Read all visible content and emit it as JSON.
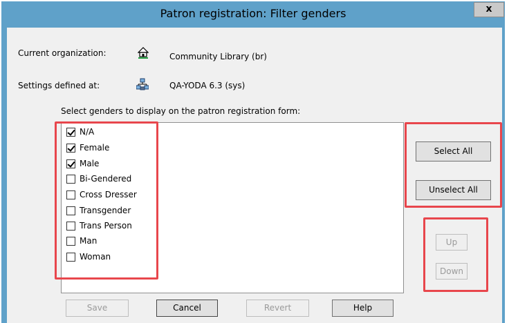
{
  "window": {
    "title": "Patron registration: Filter genders",
    "close_label": "x"
  },
  "info": {
    "current_org_label": "Current organization:",
    "current_org_value": "Community Library  (br)",
    "settings_label": "Settings defined at:",
    "settings_value": "QA-YODA 6.3 (sys)"
  },
  "instruction": "Select genders to display on the patron registration form:",
  "genders": [
    {
      "label": "N/A",
      "checked": true
    },
    {
      "label": "Female",
      "checked": true
    },
    {
      "label": "Male",
      "checked": true
    },
    {
      "label": "Bi-Gendered",
      "checked": false
    },
    {
      "label": "Cross Dresser",
      "checked": false
    },
    {
      "label": "Transgender",
      "checked": false
    },
    {
      "label": "Trans Person",
      "checked": false
    },
    {
      "label": "Man",
      "checked": false
    },
    {
      "label": "Woman",
      "checked": false
    }
  ],
  "side_buttons": {
    "select_all": "Select All",
    "unselect_all": "Unselect All",
    "up": "Up",
    "down": "Down"
  },
  "bottom_buttons": {
    "save": "Save",
    "cancel": "Cancel",
    "revert": "Revert",
    "help": "Help"
  },
  "colors": {
    "titlebar": "#5fa1c9",
    "highlight": "#e8464c"
  },
  "icons": {
    "organization": "house-icon",
    "settings": "network-icon"
  }
}
